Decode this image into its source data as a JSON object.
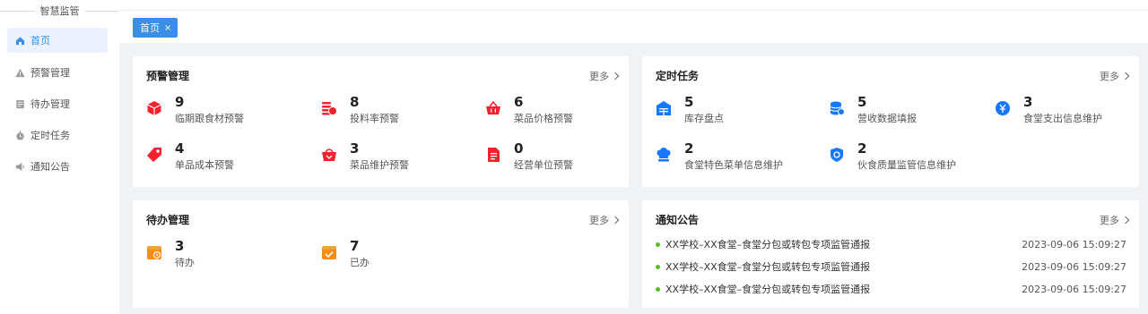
{
  "sidebar": {
    "title": "智慧监管",
    "items": [
      {
        "label": "首页",
        "icon": "home-icon"
      },
      {
        "label": "预警管理",
        "icon": "warning-icon"
      },
      {
        "label": "待办管理",
        "icon": "todo-icon"
      },
      {
        "label": "定时任务",
        "icon": "timer-icon"
      },
      {
        "label": "通知公告",
        "icon": "announcement-icon"
      }
    ]
  },
  "tabs": [
    {
      "label": "首页",
      "close": "×"
    }
  ],
  "cards": {
    "warning": {
      "title": "预警管理",
      "more": "更多",
      "stats": [
        {
          "value": "9",
          "label": "临期跟食材预警",
          "icon": "cube-icon",
          "color": "#f5222d"
        },
        {
          "value": "8",
          "label": "投料率预警",
          "icon": "coins-icon",
          "color": "#f5222d"
        },
        {
          "value": "6",
          "label": "菜品价格预警",
          "icon": "basket-icon",
          "color": "#f5222d"
        },
        {
          "value": "4",
          "label": "单品成本预警",
          "icon": "tag-icon",
          "color": "#f5222d"
        },
        {
          "value": "3",
          "label": "菜品维护预警",
          "icon": "bowl-icon",
          "color": "#f5222d"
        },
        {
          "value": "0",
          "label": "经营单位预警",
          "icon": "document-icon",
          "color": "#f5222d"
        }
      ]
    },
    "tasks": {
      "title": "定时任务",
      "more": "更多",
      "stats": [
        {
          "value": "5",
          "label": "库存盘点",
          "icon": "warehouse-icon",
          "color": "#1677ff"
        },
        {
          "value": "5",
          "label": "营收数据填报",
          "icon": "database-icon",
          "color": "#1677ff"
        },
        {
          "value": "3",
          "label": "食堂支出信息维护",
          "icon": "wallet-icon",
          "color": "#1677ff"
        },
        {
          "value": "2",
          "label": "食堂特色菜单信息维护",
          "icon": "chef-hat-icon",
          "color": "#1677ff"
        },
        {
          "value": "2",
          "label": "伙食质量监管信息维护",
          "icon": "shield-icon",
          "color": "#1677ff"
        }
      ]
    },
    "todo": {
      "title": "待办管理",
      "more": "更多",
      "stats": [
        {
          "value": "3",
          "label": "待办",
          "icon": "pending-icon",
          "color": "#fa8c16"
        },
        {
          "value": "7",
          "label": "已办",
          "icon": "done-icon",
          "color": "#fa8c16"
        }
      ]
    },
    "notices": {
      "title": "通知公告",
      "more": "更多",
      "items": [
        {
          "text": "XX学校–XX食堂–食堂分包或转包专项监管通报",
          "date": "2023-09-06 15:09:27"
        },
        {
          "text": "XX学校–XX食堂–食堂分包或转包专项监管通报",
          "date": "2023-09-06 15:09:27"
        },
        {
          "text": "XX学校–XX食堂–食堂分包或转包专项监管通报",
          "date": "2023-09-06 15:09:27"
        }
      ]
    }
  }
}
